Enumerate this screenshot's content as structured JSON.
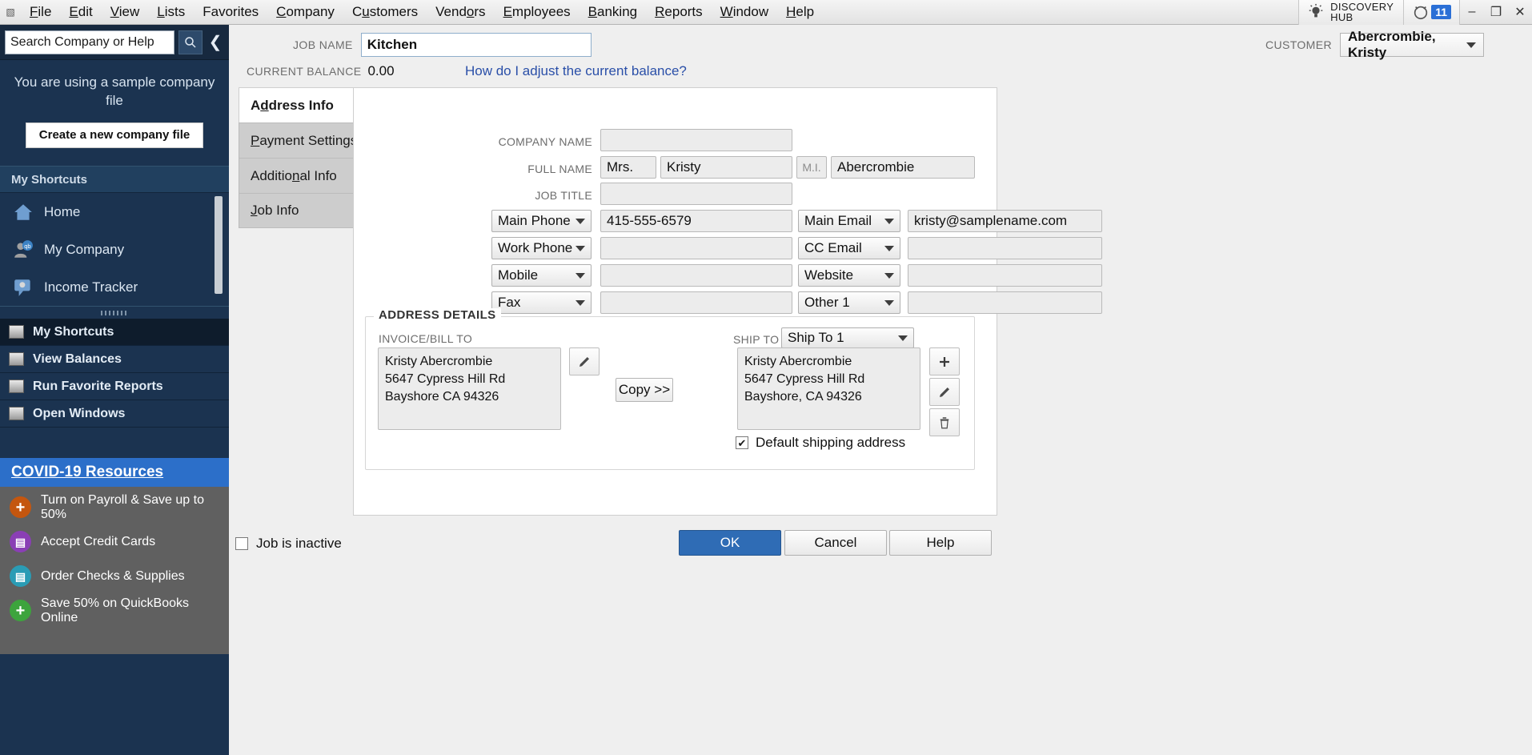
{
  "menubar": {
    "items": [
      {
        "pre": "",
        "key": "F",
        "post": "ile"
      },
      {
        "pre": "",
        "key": "E",
        "post": "dit"
      },
      {
        "pre": "",
        "key": "V",
        "post": "iew"
      },
      {
        "pre": "",
        "key": "L",
        "post": "ists"
      },
      {
        "pre": "Favorites",
        "key": "",
        "post": ""
      },
      {
        "pre": "",
        "key": "C",
        "post": "ompany"
      },
      {
        "pre": "C",
        "key": "u",
        "post": "stomers"
      },
      {
        "pre": "Vend",
        "key": "o",
        "post": "rs"
      },
      {
        "pre": "",
        "key": "E",
        "post": "mployees"
      },
      {
        "pre": "",
        "key": "B",
        "post": "anking"
      },
      {
        "pre": "",
        "key": "R",
        "post": "eports"
      },
      {
        "pre": "",
        "key": "W",
        "post": "indow"
      },
      {
        "pre": "",
        "key": "H",
        "post": "elp"
      }
    ],
    "discovery_line1": "DISCOVERY",
    "discovery_line2": "HUB",
    "alarm_count": "11",
    "minimize": "–",
    "restore": "❐",
    "close": "✕"
  },
  "sidebar": {
    "search_placeholder": "Search Company or Help",
    "search_value": "Search Company or Help",
    "sample_note": "You are using a sample company file",
    "create_button": "Create a new company file",
    "shortcuts_header": "My Shortcuts",
    "shortcuts": [
      {
        "label": "Home",
        "icon": "home-icon"
      },
      {
        "label": "My Company",
        "icon": "my-company-icon"
      },
      {
        "label": "Income Tracker",
        "icon": "income-tracker-icon"
      }
    ],
    "nav": [
      {
        "label": "My Shortcuts",
        "icon": "shortcuts-icon",
        "active": true
      },
      {
        "label": "View Balances",
        "icon": "balances-icon",
        "active": false
      },
      {
        "label": "Run Favorite Reports",
        "icon": "reports-icon",
        "active": false
      },
      {
        "label": "Open Windows",
        "icon": "windows-icon",
        "active": false
      }
    ],
    "covid_link": "COVID-19 Resources",
    "promos": [
      {
        "label": "Turn on Payroll & Save up to 50%",
        "color": "#c4560f",
        "glyph": "+"
      },
      {
        "label": "Accept Credit Cards",
        "color": "#8a3fb5",
        "glyph": "▤"
      },
      {
        "label": "Order Checks & Supplies",
        "color": "#2a9cb5",
        "glyph": "▥"
      },
      {
        "label": "Save 50% on QuickBooks Online",
        "color": "#3da43d",
        "glyph": "+"
      }
    ]
  },
  "header": {
    "job_name_label": "JOB NAME",
    "job_name_value": "Kitchen",
    "customer_label": "CUSTOMER",
    "customer_value": "Abercrombie, Kristy",
    "current_balance_label": "CURRENT BALANCE",
    "current_balance_value": "0.00",
    "adjust_link": "How do I adjust the current balance?"
  },
  "tabs": [
    {
      "pre": "A",
      "key": "d",
      "post": "dress Info",
      "active": true
    },
    {
      "pre": "",
      "key": "P",
      "post": "ayment Settings",
      "active": false
    },
    {
      "pre": "Additio",
      "key": "n",
      "post": "al Info",
      "active": false
    },
    {
      "pre": "",
      "key": "J",
      "post": "ob Info",
      "active": false
    }
  ],
  "form": {
    "company_name_label": "COMPANY NAME",
    "company_name_value": "",
    "full_name_label": "FULL NAME",
    "salutation": "Mrs.",
    "first_name": "Kristy",
    "mi_label": "M.I.",
    "mi_value": "",
    "last_name": "Abercrombie",
    "job_title_label": "JOB TITLE",
    "job_title_value": "",
    "phone_rows": [
      {
        "type": "Main Phone",
        "value": "415-555-6579"
      },
      {
        "type": "Work Phone",
        "value": ""
      },
      {
        "type": "Mobile",
        "value": ""
      },
      {
        "type": "Fax",
        "value": ""
      }
    ],
    "email_rows": [
      {
        "type": "Main Email",
        "value": "kristy@samplename.com"
      },
      {
        "type": "CC Email",
        "value": ""
      },
      {
        "type": "Website",
        "value": ""
      },
      {
        "type": "Other 1",
        "value": ""
      }
    ]
  },
  "address": {
    "group_title": "ADDRESS DETAILS",
    "bill_to_label": "INVOICE/BILL TO",
    "bill_to_value": "Kristy Abercrombie\n5647 Cypress Hill Rd\nBayshore CA 94326",
    "copy_button": "Copy >>",
    "ship_to_label": "SHIP TO",
    "ship_to_select": "Ship To 1",
    "ship_to_value": "Kristy Abercrombie\n5647 Cypress Hill Rd\nBayshore, CA 94326",
    "default_shipping_label": "Default shipping address",
    "default_shipping_checked": "✔",
    "edit_icon": "pencil-icon",
    "add_icon": "plus-icon",
    "delete_icon": "trash-icon"
  },
  "footer": {
    "inactive_label": "Job is inactive",
    "ok": "OK",
    "cancel": "Cancel",
    "help": "Help"
  }
}
